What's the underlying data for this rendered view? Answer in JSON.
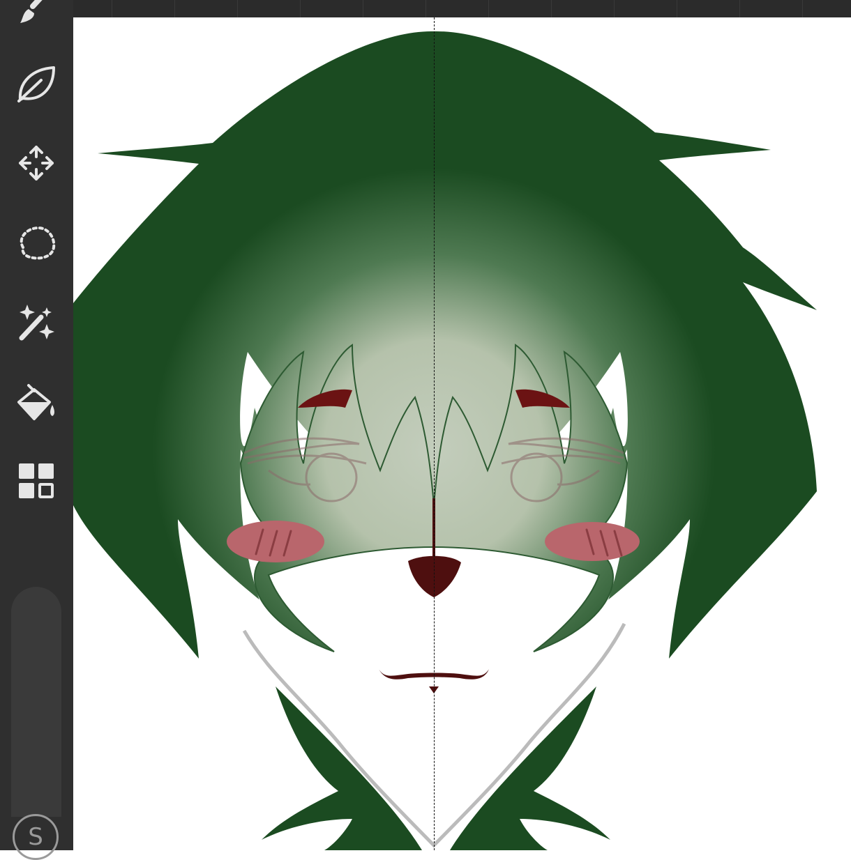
{
  "app": {
    "name": "drawing-app",
    "accent": "#2f2f2f"
  },
  "toolbar": {
    "tools": [
      {
        "name": "brush",
        "icon": "brush-icon"
      },
      {
        "name": "smudge",
        "icon": "leaf-icon"
      },
      {
        "name": "transform",
        "icon": "move-arrows-icon"
      },
      {
        "name": "lasso",
        "icon": "lasso-selection-icon"
      },
      {
        "name": "magic-wand",
        "icon": "magic-wand-icon"
      },
      {
        "name": "fill",
        "icon": "paint-bucket-icon"
      },
      {
        "name": "layers",
        "icon": "layers-grid-icon"
      }
    ],
    "store_badge_label": "S"
  },
  "canvas": {
    "symmetry_guide": "vertical",
    "colors": {
      "hair_dark": "#1b4b21",
      "hair_light": "#b5c2ab",
      "blush": "#b9666c",
      "nose": "#4e0f0f",
      "eyebrow": "#6b1313",
      "sketch": "#8b6a6a"
    }
  }
}
